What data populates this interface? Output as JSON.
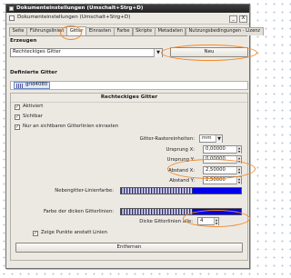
{
  "window": {
    "title": "Dokumenteinstellungen (Umschalt+Strg+D)",
    "doc_title": "Dokumenteinstellungen (Umschalt+Strg+D)",
    "buttons": [
      "_",
      "X"
    ]
  },
  "tabs": [
    {
      "label": "Seite",
      "active": false
    },
    {
      "label": "Führungslinien",
      "active": false
    },
    {
      "label": "Gitter",
      "active": true
    },
    {
      "label": "Einrasten",
      "active": false
    },
    {
      "label": "Farbe",
      "active": false
    },
    {
      "label": "Skripte",
      "active": false
    },
    {
      "label": "Metadaten",
      "active": false
    },
    {
      "label": "Nutzungsbedingungen - Lizenz",
      "active": false
    }
  ],
  "create": {
    "heading": "Erzeugen",
    "grid_type": "Rechteckiges Gitter",
    "new_label": "Neu"
  },
  "defined": {
    "heading": "Definierte Gitter",
    "items": [
      {
        "label": "grid4080"
      }
    ]
  },
  "panel": {
    "title": "Rechteckiges Gitter",
    "checks": {
      "enabled": {
        "label": "Aktiviert",
        "checked": true
      },
      "visible": {
        "label": "Sichtbar",
        "checked": true
      },
      "snap_visible": {
        "label": "Nur an sichtbaren Gitterlinien einrasten",
        "checked": true
      },
      "dots": {
        "label": "Zeige Punkte anstatt Linien",
        "checked": true
      }
    },
    "units": {
      "label": "Gitter-Rastereinheiten:",
      "value": "mm"
    },
    "origin_x": {
      "label": "Ursprung X:",
      "value": "0,00000"
    },
    "origin_y": {
      "label": "Ursprung Y:",
      "value": "0,00000"
    },
    "spacing_x": {
      "label": "Abstand X:",
      "value": "2,50000"
    },
    "spacing_y": {
      "label": "Abstand Y:",
      "value": "2,50000"
    },
    "minor_color": {
      "label": "Nebengitter-Linienfarbe:"
    },
    "major_color": {
      "label": "Farbe der dicken Gitterlinien:"
    },
    "major_every": {
      "label": "Dicke Gitterlinien alle:",
      "value": "4"
    },
    "remove_label": "Entfernen"
  },
  "colors": {
    "accent_highlight": "#f08a2a",
    "grid_line_blue": "#0000ee"
  }
}
